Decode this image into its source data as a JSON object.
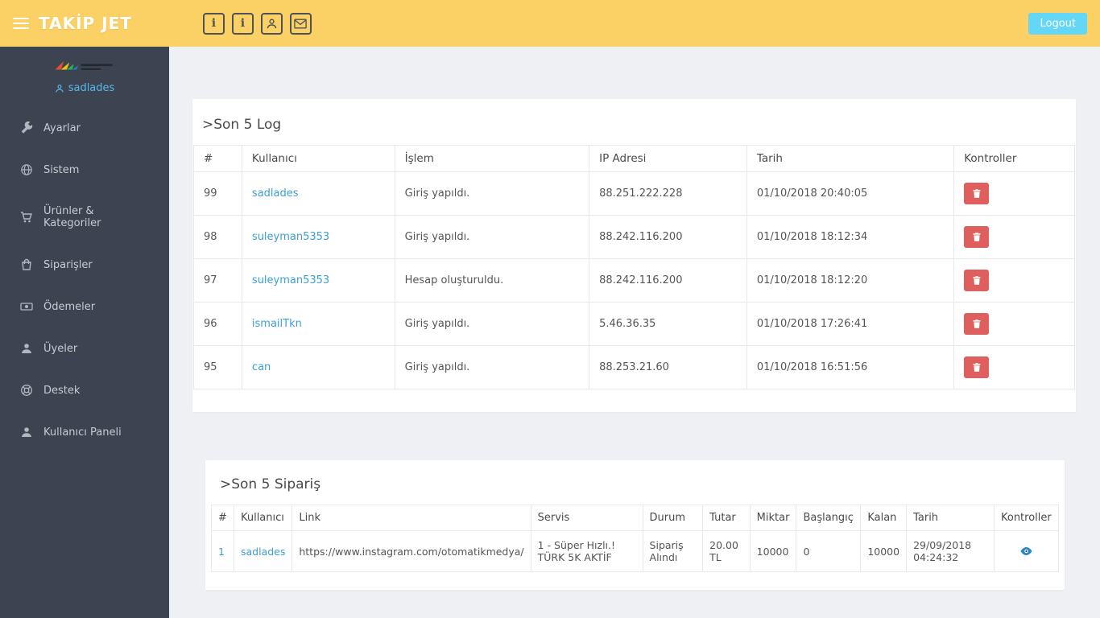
{
  "colors": {
    "header_bg": "#fbd064",
    "logout_bg": "#63d7f5",
    "sidebar_bg": "#3d4451",
    "link_blue": "#3a9fd8",
    "danger_red": "#df5e5e",
    "main_bg": "#eef0f4"
  },
  "header": {
    "title": "TAKİP JET",
    "logout_label": "Logout",
    "icons": [
      "info-icon",
      "info-icon",
      "user-icon",
      "mail-icon"
    ]
  },
  "sidebar": {
    "username": "sadlades",
    "items": [
      {
        "label": "Ayarlar",
        "icon": "wrench-icon"
      },
      {
        "label": "Sistem",
        "icon": "globe-icon"
      },
      {
        "label": "Ürünler & Kategoriler",
        "icon": "cart-icon"
      },
      {
        "label": "Siparişler",
        "icon": "bag-icon"
      },
      {
        "label": "Ödemeler",
        "icon": "banknote-icon"
      },
      {
        "label": "Üyeler",
        "icon": "users-icon"
      },
      {
        "label": "Destek",
        "icon": "support-icon"
      },
      {
        "label": "Kullanıcı Paneli",
        "icon": "user-icon"
      }
    ]
  },
  "log": {
    "title": ">Son 5 Log",
    "columns": [
      "#",
      "Kullanıcı",
      "İşlem",
      "IP Adresi",
      "Tarih",
      "Kontroller"
    ],
    "rows": [
      {
        "id": "99",
        "user": "sadlades",
        "action": "Giriş yapıldı.",
        "ip": "88.251.222.228",
        "date": "01/10/2018 20:40:05"
      },
      {
        "id": "98",
        "user": "suleyman5353",
        "action": "Giriş yapıldı.",
        "ip": "88.242.116.200",
        "date": "01/10/2018 18:12:34"
      },
      {
        "id": "97",
        "user": "suleyman5353",
        "action": "Hesap oluşturuldu.",
        "ip": "88.242.116.200",
        "date": "01/10/2018 18:12:20"
      },
      {
        "id": "96",
        "user": "ismailTkn",
        "action": "Giriş yapıldı.",
        "ip": "5.46.36.35",
        "date": "01/10/2018 17:26:41"
      },
      {
        "id": "95",
        "user": "can",
        "action": "Giriş yapıldı.",
        "ip": "88.253.21.60",
        "date": "01/10/2018 16:51:56"
      }
    ],
    "action_icon": "trash-icon"
  },
  "orders": {
    "title": ">Son 5 Sipariş",
    "columns": [
      "#",
      "Kullanıcı",
      "Link",
      "Servis",
      "Durum",
      "Tutar",
      "Miktar",
      "Başlangıç",
      "Kalan",
      "Tarih",
      "Kontroller"
    ],
    "rows": [
      {
        "id": "1",
        "user": "sadlades",
        "link": "https://www.instagram.com/otomatikmedya/",
        "service": "1 - Süper Hızlı.! TÜRK 5K AKTİF",
        "status": "Sipariş Alındı",
        "price": "20.00 TL",
        "quantity": "10000",
        "start": "0",
        "remaining": "10000",
        "date": "29/09/2018 04:24:32"
      }
    ],
    "action_icon": "eye-icon"
  }
}
